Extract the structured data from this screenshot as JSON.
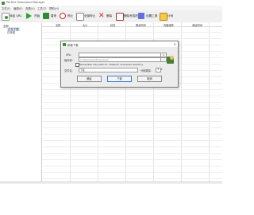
{
  "window": {
    "title": "Perfect Download Manager"
  },
  "menu": [
    "文件(F)",
    "编辑(E)",
    "查看(V)",
    "工具(T)",
    "帮助(H)"
  ],
  "toolbar": {
    "add": "添加 URL",
    "start": "开始",
    "pause": "暂停",
    "stop": "停止",
    "stop_all": "全部停止",
    "delete": "删除",
    "delete_completed": "删除完成的",
    "options": "设置工具",
    "scheduler": "计划"
  },
  "tree": {
    "root": "全部",
    "item1": "正在下载",
    "item2": "已完成"
  },
  "columns": [
    "名称",
    "大小",
    "状态",
    "剩余时间",
    "传输速率",
    "添加时间"
  ],
  "dialog": {
    "title": "新建下载",
    "url_label": "URL:",
    "url_value": "",
    "save_label": "保存到:",
    "save_path": "C:\\Users\\User\\Downloads",
    "remember_label": "Remember this path for \"Default\" download directory",
    "filename_label": "文件名:",
    "filename_value": "下载",
    "split_label": "分段数量:",
    "split_value": "5",
    "browse": "...",
    "ok": "确定",
    "download": "下载",
    "cancel": "取消"
  }
}
